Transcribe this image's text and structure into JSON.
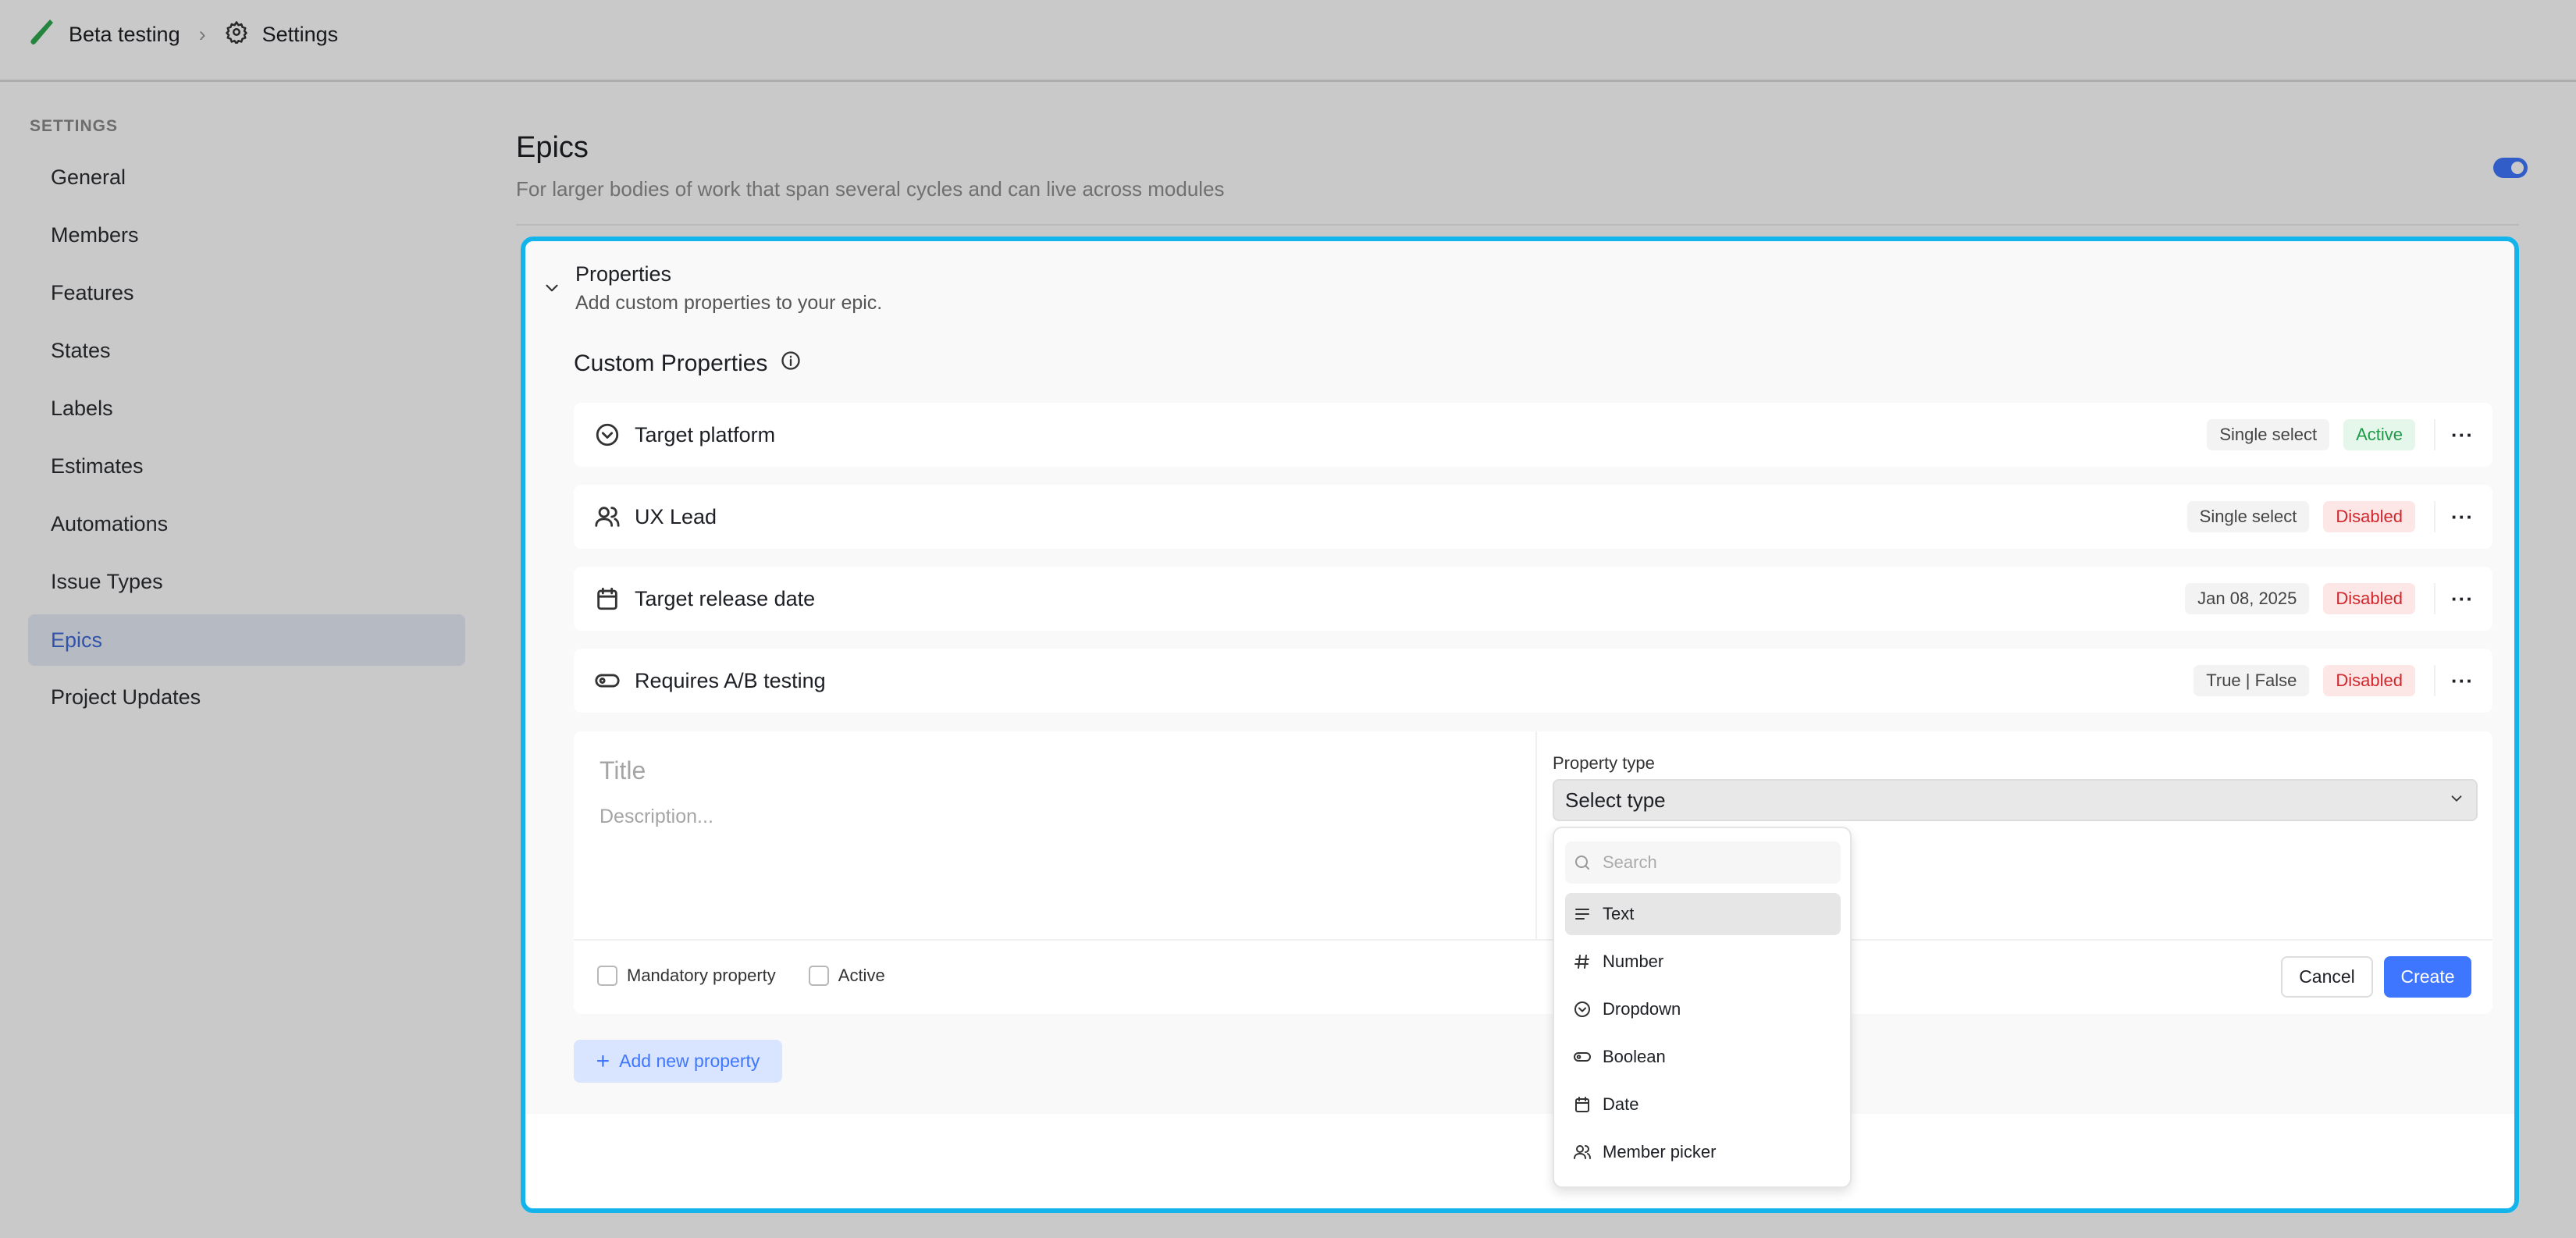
{
  "breadcrumb": {
    "project": "Beta testing",
    "page": "Settings"
  },
  "sidebar": {
    "section_label": "SETTINGS",
    "items": [
      {
        "label": "General"
      },
      {
        "label": "Members"
      },
      {
        "label": "Features"
      },
      {
        "label": "States"
      },
      {
        "label": "Labels"
      },
      {
        "label": "Estimates"
      },
      {
        "label": "Automations"
      },
      {
        "label": "Issue Types"
      },
      {
        "label": "Epics",
        "active": true
      },
      {
        "label": "Project Updates"
      }
    ]
  },
  "main": {
    "title": "Epics",
    "description": "For larger bodies of work that span several cycles and can live across modules",
    "enabled": true
  },
  "properties": {
    "title": "Properties",
    "subtitle": "Add custom properties to your epic.",
    "custom_title": "Custom Properties",
    "items": [
      {
        "icon": "dropdown-icon",
        "name": "Target platform",
        "type": "Single select",
        "status": "Active"
      },
      {
        "icon": "users-icon",
        "name": "UX Lead",
        "type": "Single select",
        "status": "Disabled"
      },
      {
        "icon": "calendar-icon",
        "name": "Target release date",
        "type": "Jan 08, 2025",
        "status": "Disabled"
      },
      {
        "icon": "toggle-icon",
        "name": "Requires A/B testing",
        "type": "True | False",
        "status": "Disabled"
      }
    ]
  },
  "form": {
    "title_placeholder": "Title",
    "description_placeholder": "Description...",
    "property_type_label": "Property type",
    "select_placeholder": "Select type",
    "mandatory_label": "Mandatory property",
    "active_label": "Active",
    "cancel": "Cancel",
    "create": "Create"
  },
  "dropdown": {
    "search_placeholder": "Search",
    "options": [
      {
        "icon": "text-icon",
        "label": "Text",
        "highlighted": true
      },
      {
        "icon": "hash-icon",
        "label": "Number"
      },
      {
        "icon": "dropdown-icon",
        "label": "Dropdown"
      },
      {
        "icon": "toggle-icon",
        "label": "Boolean"
      },
      {
        "icon": "calendar-icon",
        "label": "Date"
      },
      {
        "icon": "users-icon",
        "label": "Member picker"
      }
    ]
  },
  "add_property": "Add new property",
  "colors": {
    "accent": "#3f76ff",
    "highlight_border": "#13b3ec",
    "active": "#1f9a49",
    "disabled": "#d1262c"
  }
}
